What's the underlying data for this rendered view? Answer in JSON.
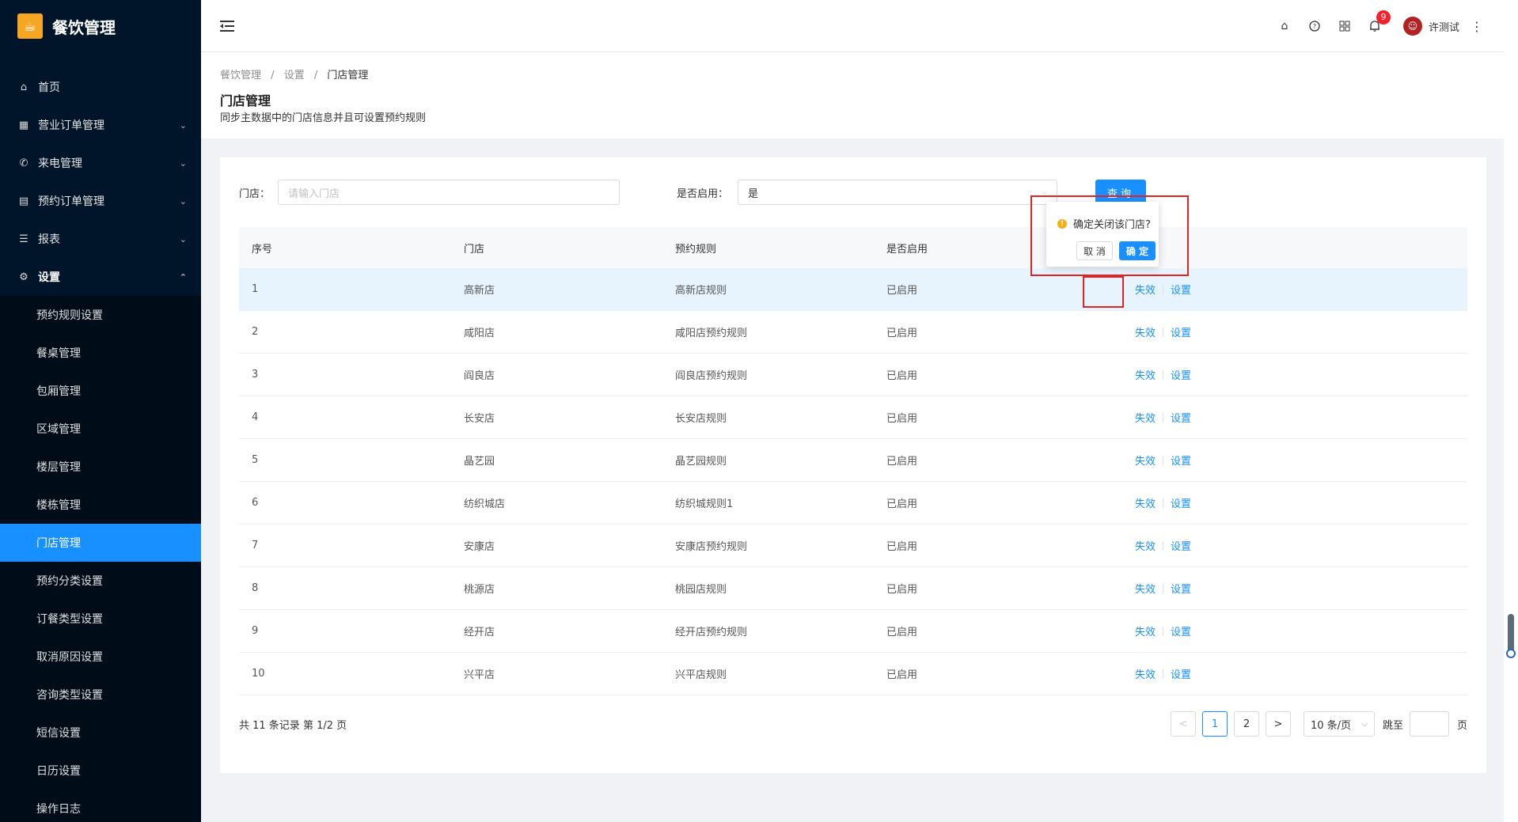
{
  "app": {
    "title": "餐饮管理"
  },
  "menu": [
    {
      "label": "首页",
      "icon": "home-icon",
      "arrow": ""
    },
    {
      "label": "营业订单管理",
      "icon": "order-icon",
      "arrow": "⌄"
    },
    {
      "label": "来电管理",
      "icon": "phone-icon",
      "arrow": "⌄"
    },
    {
      "label": "预约订单管理",
      "icon": "list-icon",
      "arrow": "⌄"
    },
    {
      "label": "报表",
      "icon": "report-icon",
      "arrow": "⌄"
    },
    {
      "label": "设置",
      "icon": "gear-icon",
      "arrow": "⌃"
    }
  ],
  "submenu": [
    "预约规则设置",
    "餐桌管理",
    "包厢管理",
    "区域管理",
    "楼层管理",
    "楼栋管理",
    "门店管理",
    "预约分类设置",
    "订餐类型设置",
    "取消原因设置",
    "咨询类型设置",
    "短信设置",
    "日历设置",
    "操作日志"
  ],
  "header": {
    "badge": "9",
    "user": "许测试"
  },
  "breadcrumb": {
    "a": "餐饮管理",
    "sep": "/",
    "b": "设置",
    "c": "门店管理"
  },
  "page": {
    "title": "门店管理",
    "desc": "同步主数据中的门店信息并且可设置预约规则"
  },
  "filter": {
    "store_label": "门店：",
    "store_placeholder": "请输入门店",
    "enabled_label": "是否启用：",
    "enabled_value": "是",
    "query": "查询"
  },
  "table": {
    "headers": [
      "序号",
      "门店",
      "预约规则",
      "是否启用"
    ],
    "rows": [
      [
        "1",
        "高新店",
        "高新店规则",
        "已启用"
      ],
      [
        "2",
        "咸阳店",
        "咸阳店预约规则",
        "已启用"
      ],
      [
        "3",
        "阎良店",
        "阎良店预约规则",
        "已启用"
      ],
      [
        "4",
        "长安店",
        "长安店规则",
        "已启用"
      ],
      [
        "5",
        "晶艺园",
        "晶艺园规则",
        "已启用"
      ],
      [
        "6",
        "纺织城店",
        "纺织城规则1",
        "已启用"
      ],
      [
        "7",
        "安康店",
        "安康店预约规则",
        "已启用"
      ],
      [
        "8",
        "桃源店",
        "桃园店规则",
        "已启用"
      ],
      [
        "9",
        "经开店",
        "经开店预约规则",
        "已启用"
      ],
      [
        "10",
        "兴平店",
        "兴平店规则",
        "已启用"
      ]
    ],
    "action_disable": "失效",
    "action_setting": "设置"
  },
  "footer": {
    "total": "共 11 条记录 第 1/2 页",
    "prev": "<",
    "next": ">",
    "pages": [
      "1",
      "2"
    ],
    "page_size": "10 条/页",
    "jump": "跳至",
    "unit": "页"
  },
  "popconfirm": {
    "message": "确定关闭该门店?",
    "cancel": "取 消",
    "ok": "确 定"
  },
  "colors": {
    "primary": "#1890ff",
    "sidebar": "#001529",
    "highlight": "#e02424"
  }
}
